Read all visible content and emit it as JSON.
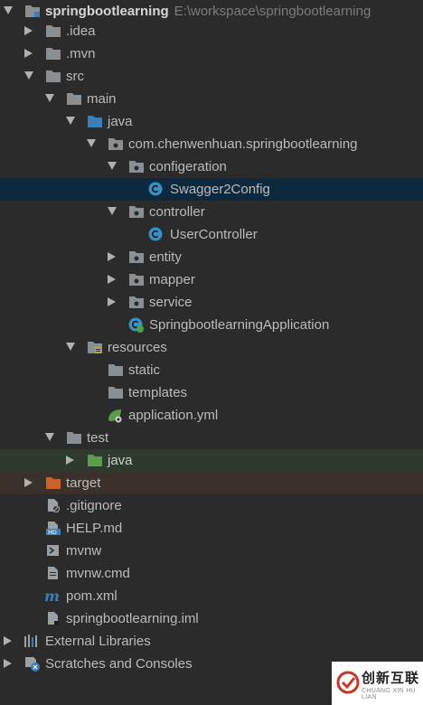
{
  "project": {
    "name": "springbootlearning",
    "path": "E:\\workspace\\springbootlearning"
  },
  "tree": [
    {
      "label": "springbootlearning"
    },
    {
      "label": ".idea"
    },
    {
      "label": ".mvn"
    },
    {
      "label": "src"
    },
    {
      "label": "main"
    },
    {
      "label": "java"
    },
    {
      "label": "com.chenwenhuan.springbootlearning"
    },
    {
      "label": "configeration"
    },
    {
      "label": "Swagger2Config"
    },
    {
      "label": "controller"
    },
    {
      "label": "UserController"
    },
    {
      "label": "entity"
    },
    {
      "label": "mapper"
    },
    {
      "label": "service"
    },
    {
      "label": "SpringbootlearningApplication"
    },
    {
      "label": "resources"
    },
    {
      "label": "static"
    },
    {
      "label": "templates"
    },
    {
      "label": "application.yml"
    },
    {
      "label": "test"
    },
    {
      "label": "java"
    },
    {
      "label": "target"
    },
    {
      "label": ".gitignore"
    },
    {
      "label": "HELP.md"
    },
    {
      "label": "mvnw"
    },
    {
      "label": "mvnw.cmd"
    },
    {
      "label": "pom.xml"
    },
    {
      "label": "springbootlearning.iml"
    },
    {
      "label": "External Libraries"
    },
    {
      "label": "Scratches and Consoles"
    }
  ],
  "watermark": {
    "text": "创新互联",
    "sub": "CHUANG XIN HU LIAN"
  },
  "colors": {
    "background": "#2b2b2b",
    "selected_row": "#0d293e",
    "folder": "#8a8f94",
    "source_folder": "#3d7db8",
    "test_folder": "#5a9e4b",
    "excluded_folder": "#c8632b",
    "class_icon": "#3592c4"
  }
}
